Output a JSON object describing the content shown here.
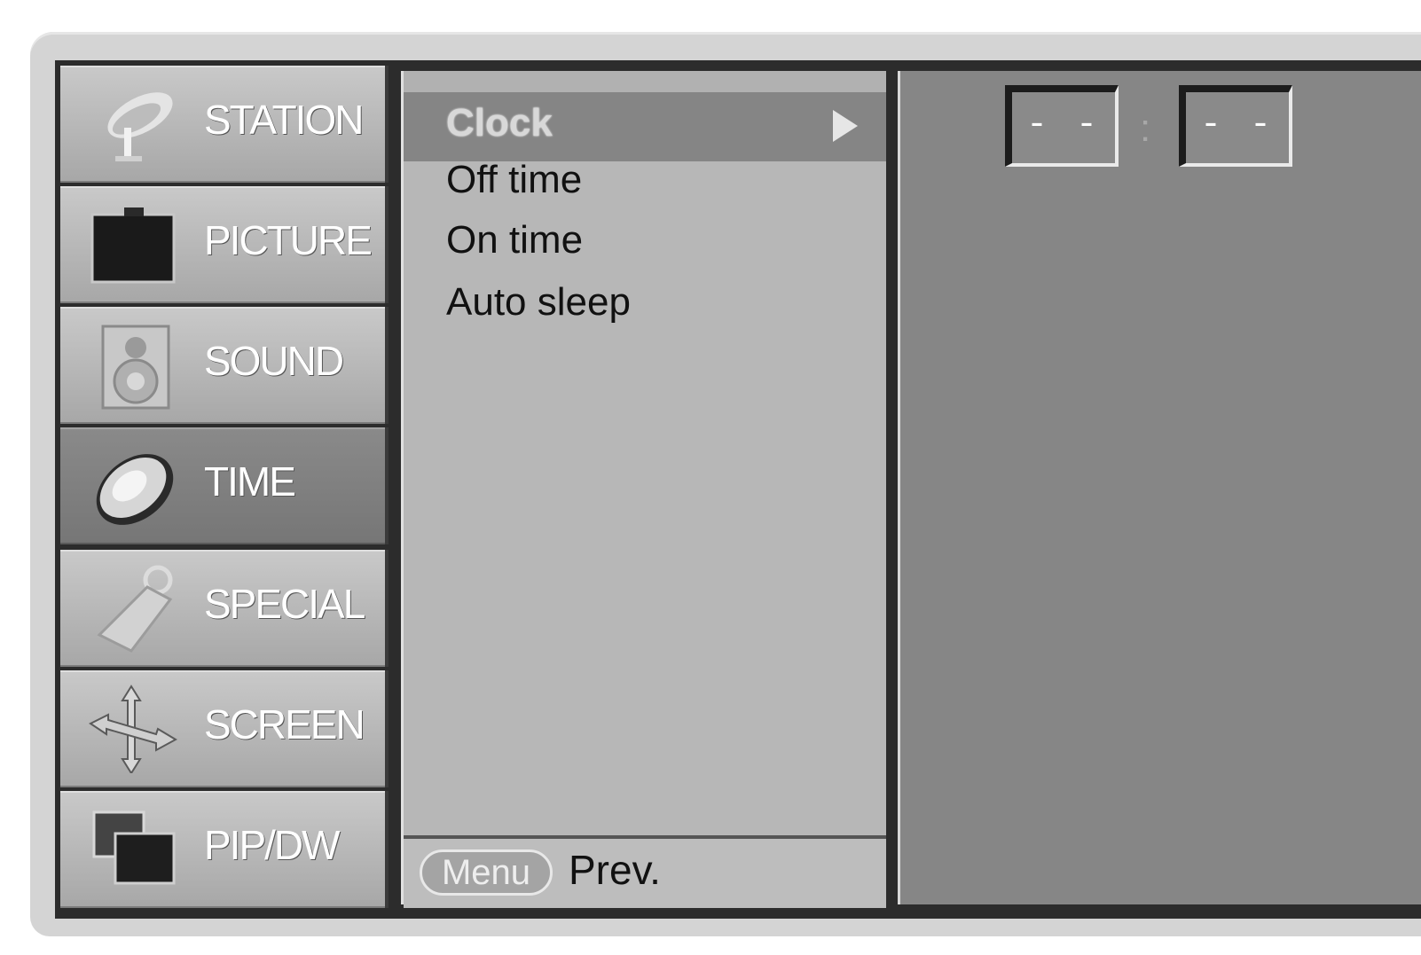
{
  "categories": [
    {
      "label": "STATION",
      "icon": "satellite-dish-icon",
      "selected": false
    },
    {
      "label": "PICTURE",
      "icon": "tv-screen-icon",
      "selected": false
    },
    {
      "label": "SOUND",
      "icon": "speaker-icon",
      "selected": false
    },
    {
      "label": "TIME",
      "icon": "clock-icon",
      "selected": true
    },
    {
      "label": "SPECIAL",
      "icon": "key-tag-icon",
      "selected": false
    },
    {
      "label": "SCREEN",
      "icon": "move-arrows-icon",
      "selected": false
    },
    {
      "label": "PIP/DW",
      "icon": "pip-windows-icon",
      "selected": false
    }
  ],
  "submenu": {
    "highlighted": "Clock",
    "items": [
      "Off time",
      "On time",
      "Auto sleep"
    ],
    "footer": {
      "key_label": "Menu",
      "action_label": "Prev."
    }
  },
  "clock": {
    "hour": "- -",
    "separator": ":",
    "minute": "- -"
  },
  "colors": {
    "category_bg": "#b8b8b8",
    "category_selected_bg": "#808080",
    "submenu_bg": "#b7b7b7",
    "value_bg": "#868686"
  }
}
